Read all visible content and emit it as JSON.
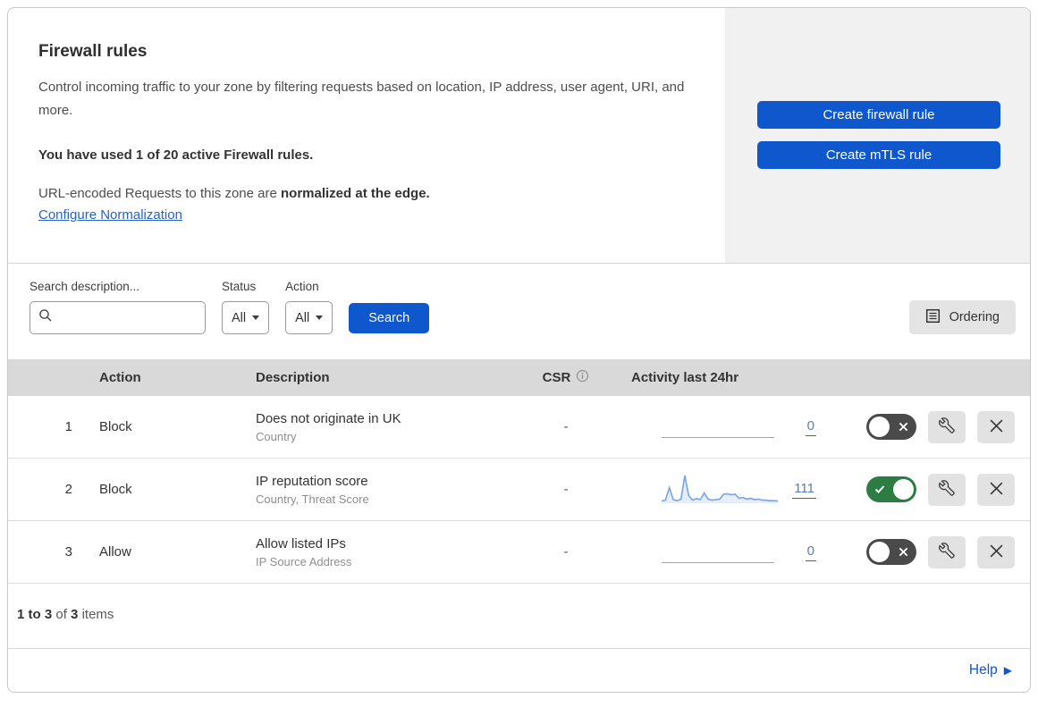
{
  "colors": {
    "accent_blue": "#0e57cd",
    "link_blue": "#2464c8",
    "panel_gray": "#f1f1f1",
    "table_header_gray": "#d9d9d9",
    "toggle_on_green": "#2c7c43",
    "toggle_off_gray": "#4a4a4a",
    "sparkline_blue": "#76a3e8"
  },
  "header": {
    "title": "Firewall rules",
    "description": "Control incoming traffic to your zone by filtering requests based on location, IP address, user agent, URI, and more.",
    "usage_bold": "You have used 1 of 20 active Firewall rules.",
    "normalization_prefix": "URL-encoded Requests to this zone are ",
    "normalization_bold": "normalized at the edge.",
    "normalization_link": "Configure Normalization",
    "buttons": [
      {
        "label": "Create firewall rule"
      },
      {
        "label": "Create mTLS rule"
      }
    ]
  },
  "filters": {
    "search_label": "Search description...",
    "status_label": "Status",
    "status_value": "All",
    "action_label": "Action",
    "action_value": "All",
    "search_button": "Search",
    "ordering_button": "Ordering"
  },
  "table": {
    "columns": {
      "action": "Action",
      "description": "Description",
      "csr": "CSR",
      "activity": "Activity last 24hr"
    },
    "rows": [
      {
        "priority": "1",
        "action": "Block",
        "description": "Does not originate in UK",
        "fields": "Country",
        "csr": "-",
        "activity_count": "0",
        "enabled": false,
        "sparkline": []
      },
      {
        "priority": "2",
        "action": "Block",
        "description": "IP reputation score",
        "fields": "Country, Threat Score",
        "csr": "-",
        "activity_count": "111",
        "enabled": true,
        "sparkline": [
          5,
          8,
          55,
          10,
          6,
          12,
          100,
          25,
          8,
          14,
          10,
          35,
          12,
          8,
          10,
          12,
          30,
          32,
          28,
          30,
          15,
          18,
          12,
          15,
          10,
          12,
          8,
          8,
          6,
          6,
          5
        ]
      },
      {
        "priority": "3",
        "action": "Allow",
        "description": "Allow listed IPs",
        "fields": "IP Source Address",
        "csr": "-",
        "activity_count": "0",
        "enabled": false,
        "sparkline": []
      }
    ],
    "summary": {
      "range": "1 to 3",
      "of": "of",
      "total": "3",
      "items": "items"
    }
  },
  "footer": {
    "help": "Help"
  }
}
